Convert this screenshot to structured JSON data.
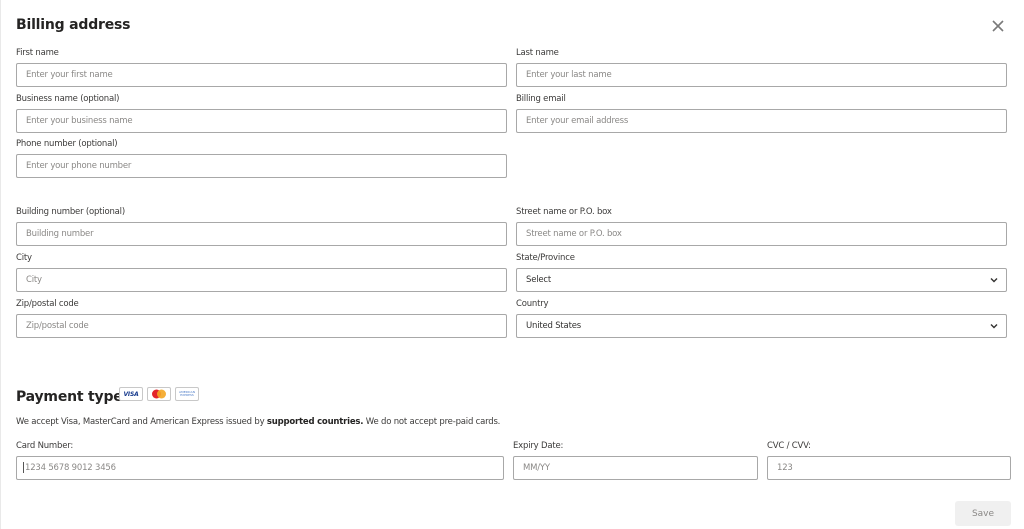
{
  "billing": {
    "title": "Billing address",
    "close_icon": "close-icon",
    "fields": {
      "first_name": {
        "label": "First name",
        "placeholder": "Enter your first name"
      },
      "last_name": {
        "label": "Last name",
        "placeholder": "Enter your last name"
      },
      "business_name": {
        "label": "Business name (optional)",
        "placeholder": "Enter your business name"
      },
      "billing_email": {
        "label": "Billing email",
        "placeholder": "Enter your email address"
      },
      "phone": {
        "label": "Phone number (optional)",
        "placeholder": "Enter your phone number"
      },
      "building": {
        "label": "Building number (optional)",
        "placeholder": "Building number"
      },
      "street": {
        "label": "Street name or P.O. box",
        "placeholder": "Street name or P.O. box"
      },
      "city": {
        "label": "City",
        "placeholder": "City"
      },
      "state": {
        "label": "State/Province",
        "value": "Select",
        "icon": "chevron-down-icon"
      },
      "zip": {
        "label": "Zip/postal code",
        "placeholder": "Zip/postal code"
      },
      "country": {
        "label": "Country",
        "value": "United States",
        "icon": "chevron-down-icon"
      }
    }
  },
  "payment": {
    "title": "Payment type",
    "card_logos": [
      {
        "name": "visa-logo",
        "text": "VISA"
      },
      {
        "name": "mastercard-logo",
        "text": ""
      },
      {
        "name": "amex-logo",
        "text": "AMERICAN EXPRESS"
      }
    ],
    "note_prefix": "We accept Visa, MasterCard and American Express issued by ",
    "note_link": "supported countries.",
    "note_suffix": " We do not accept pre-paid cards.",
    "fields": {
      "card_number": {
        "label": "Card Number:",
        "placeholder": "1234 5678 9012 3456"
      },
      "expiry": {
        "label": "Expiry Date:",
        "placeholder": "MM/YY"
      },
      "cvc": {
        "label": "CVC / CVV:",
        "placeholder": "123"
      }
    }
  },
  "actions": {
    "save_label": "Save"
  },
  "colors": {
    "border": "#a8a8a8",
    "placeholder": "#8a8886",
    "save_bg": "#f0f0f0"
  }
}
